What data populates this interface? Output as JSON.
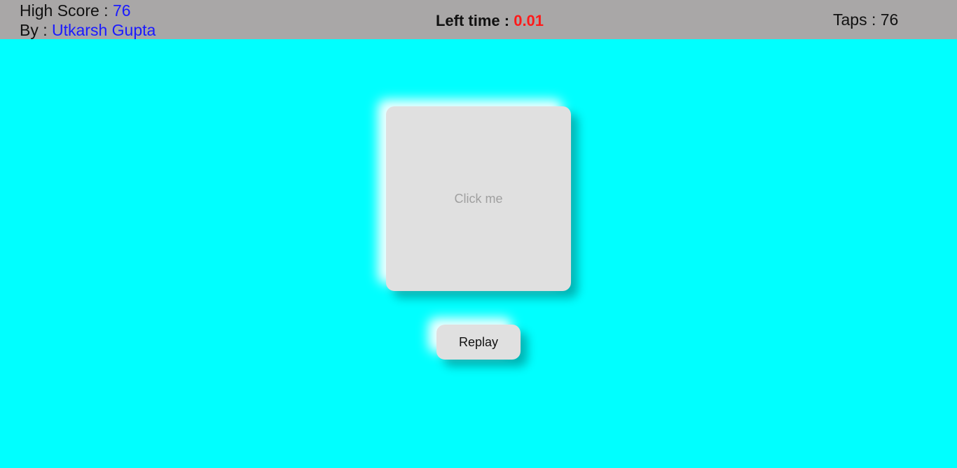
{
  "header": {
    "high_score_label": "High Score : ",
    "high_score_value": "76",
    "by_label": "By : ",
    "author": "Utkarsh Gupta",
    "left_time_label": "Left time : ",
    "left_time_value": "0.01",
    "taps_label": "Taps : ",
    "taps_value": "76"
  },
  "game": {
    "tap_box_label": "Click me",
    "replay_label": "Replay"
  },
  "colors": {
    "background": "#00ffff",
    "topbar": "#a9a7a7",
    "score_value": "#1a1aff",
    "time_value": "#ff1a1a",
    "box": "#e0e0e0"
  }
}
